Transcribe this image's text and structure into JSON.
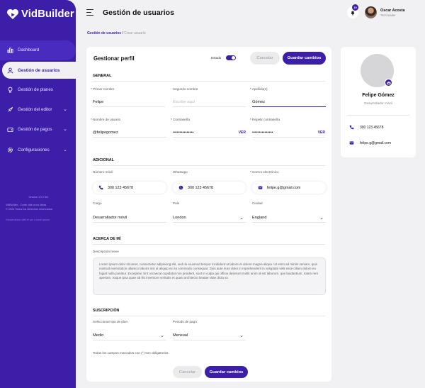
{
  "brand": {
    "name": "VidBuilder",
    "accent": "#3d1ea8"
  },
  "sidebar": {
    "items": [
      {
        "label": "Dashboard",
        "icon": "chart-icon"
      },
      {
        "label": "Gestión de usuarios",
        "icon": "user-icon"
      },
      {
        "label": "Gestión de planes",
        "icon": "bulb-icon"
      },
      {
        "label": "Gestión del editor",
        "icon": "rocket-icon"
      },
      {
        "label": "Gestión de pagos",
        "icon": "wallet-icon"
      },
      {
        "label": "Configuraciones",
        "icon": "gear-icon"
      }
    ],
    "footer": {
      "version": "Version 1.0.0 fid",
      "line1": "VidBuilder - Crate vide a tus ideas",
      "line2": "© 2024 Todos los derechos reservados",
      "line3": "Desarrollado with ♥ por Lorem ipsum"
    }
  },
  "header": {
    "title": "Gestión de usuarios",
    "notifications": "10",
    "user_name": "Oscar Acosta",
    "user_role": "Tech leader"
  },
  "breadcrumb": {
    "parent": "Gestión de usuarios",
    "sep": "/",
    "current": "Crear usuario"
  },
  "form": {
    "title": "Gestionar perfil",
    "status_label": "Estado",
    "cancel_label": "Cancelar",
    "save_label": "Guardar cambios",
    "general": {
      "heading": "GENERAL",
      "first_name_label": "Primer nombre",
      "first_name": "Felipe",
      "second_name_label": "Segundo nombre",
      "second_name_placeholder": "Escribe aquí",
      "last_name_label": "Apellido(s)",
      "last_name": "Gómez",
      "username_label": "Nombre de usuario",
      "username": "@felipegomez",
      "password_label": "Contraseña",
      "password": "•••••••••••••••",
      "repeat_password_label": "Repetir contraseña",
      "repeat_password": "•••••••••••••••",
      "show_label": "VER"
    },
    "additional": {
      "heading": "ADICIONAL",
      "mobile_label": "Número móvil",
      "mobile": "300 123 45678",
      "whatsapp_label": "Whatsapp",
      "whatsapp": "300 123 45678",
      "email_label": "Correo electrónico",
      "email": "felipe.g@gmail.com",
      "position_label": "Cargo",
      "position": "Desarrollador móvil",
      "country_label": "País",
      "country": "London",
      "city_label": "Ciudad",
      "city": "England"
    },
    "about": {
      "heading": "ACERCA DE MÍ",
      "desc_label": "Descripción breve",
      "description": "Lorem ipsum dolor sit amet, consectetur adipiscing elit, sed do eiusmod tempor incididunt ut labore et dolore magna aliqua. Ut enim ad minim veniam, quis nostrud exercitation ullamco laboris nisi ut aliquip ex ea commodo consequat. Duis aute irure dolor in reprehenderit in voluptate velit esse cillum dolore eu fugiat nulla pariatur. Excepteur sint occaecat cupidatat non proident, sunt in culpa qui officia deserunt mollit anim id est laborum. que laudantium, totam rem aperiam, eaque ipsa quae ab illo inventore veritatis et quasi architecto beatae vitae dicta su"
    },
    "subscription": {
      "heading": "SUSCRIPCIÓN",
      "plan_label": "Seleccionar tipo de plan",
      "plan": "Medio",
      "period_label": "Periodo de pago",
      "period": "Mensual"
    },
    "required_note": "Todos los campos marcados con (*) son obligatorios."
  },
  "profile": {
    "name": "Felipe Gómez",
    "role": "Desarrollador móvil",
    "phone": "300 123 45678",
    "email": "felipe.g@gmail.com"
  }
}
